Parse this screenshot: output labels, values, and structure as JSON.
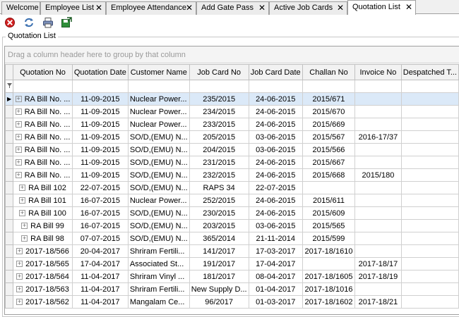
{
  "tabs": [
    {
      "label": "Welcome",
      "closable": false
    },
    {
      "label": "Employee List",
      "closable": true
    },
    {
      "label": "Employee Attendance",
      "closable": true
    },
    {
      "label": "Add Gate Pass",
      "closable": true
    },
    {
      "label": "Active Job Cards",
      "closable": true
    },
    {
      "label": "Quotation List",
      "closable": true,
      "active": true
    }
  ],
  "toolbar": {
    "icons": [
      "delete-icon",
      "refresh-icon",
      "print-icon",
      "export-icon"
    ]
  },
  "groupbox_title": "Quotation List",
  "grid": {
    "group_panel_hint": "Drag a column header here to group by that column",
    "columns": [
      "Quotation No",
      "Quotation Date",
      "Customer Name",
      "Job Card No",
      "Job Card Date",
      "Challan No",
      "Invoice No",
      "Despatched T..."
    ],
    "rows": [
      [
        "RA Bill No. ...",
        "11-09-2015",
        "Nuclear Power...",
        "235/2015",
        "24-06-2015",
        "2015/671",
        "",
        ""
      ],
      [
        "RA Bill No. ...",
        "11-09-2015",
        "Nuclear Power...",
        "234/2015",
        "24-06-2015",
        "2015/670",
        "",
        ""
      ],
      [
        "RA Bill No. ...",
        "11-09-2015",
        "Nuclear Power...",
        "233/2015",
        "24-06-2015",
        "2015/669",
        "",
        ""
      ],
      [
        "RA Bill No. ...",
        "11-09-2015",
        "SO/D,(EMU) N...",
        "205/2015",
        "03-06-2015",
        "2015/567",
        "2016-17/37",
        ""
      ],
      [
        "RA Bill No. ...",
        "11-09-2015",
        "SO/D,(EMU) N...",
        "204/2015",
        "03-06-2015",
        "2015/566",
        "",
        ""
      ],
      [
        "RA Bill No. ...",
        "11-09-2015",
        "SO/D,(EMU) N...",
        "231/2015",
        "24-06-2015",
        "2015/667",
        "",
        ""
      ],
      [
        "RA Bill No. ...",
        "11-09-2015",
        "SO/D,(EMU) N...",
        "232/2015",
        "24-06-2015",
        "2015/668",
        "2015/180",
        ""
      ],
      [
        "RA Bill 102",
        "22-07-2015",
        "SO/D,(EMU) N...",
        "RAPS 34",
        "22-07-2015",
        "",
        "",
        ""
      ],
      [
        "RA Bill 101",
        "16-07-2015",
        "Nuclear Power...",
        "252/2015",
        "24-06-2015",
        "2015/611",
        "",
        ""
      ],
      [
        "RA Bill 100",
        "16-07-2015",
        "SO/D,(EMU) N...",
        "230/2015",
        "24-06-2015",
        "2015/609",
        "",
        ""
      ],
      [
        "RA Bill 99",
        "16-07-2015",
        "SO/D,(EMU) N...",
        "203/2015",
        "03-06-2015",
        "2015/565",
        "",
        ""
      ],
      [
        "RA Bill 98",
        "07-07-2015",
        "SO/D,(EMU) N...",
        "365/2014",
        "21-11-2014",
        "2015/599",
        "",
        ""
      ],
      [
        "2017-18/566",
        "20-04-2017",
        "Shriram Fertili...",
        "141/2017",
        "17-03-2017",
        "2017-18/1610",
        "",
        ""
      ],
      [
        "2017-18/565",
        "17-04-2017",
        "Associated St...",
        "191/2017",
        "17-04-2017",
        "",
        "2017-18/17",
        ""
      ],
      [
        "2017-18/564",
        "11-04-2017",
        "Shriram Vinyl ...",
        "181/2017",
        "08-04-2017",
        "2017-18/1605",
        "2017-18/19",
        ""
      ],
      [
        "2017-18/563",
        "11-04-2017",
        "Shriram Fertili...",
        "New Supply D...",
        "01-04-2017",
        "2017-18/1016",
        "",
        ""
      ],
      [
        "2017-18/562",
        "11-04-2017",
        "Mangalam Ce...",
        "96/2017",
        "01-03-2017",
        "2017-18/1602",
        "2017-18/21",
        ""
      ]
    ],
    "selected_row": 0
  }
}
